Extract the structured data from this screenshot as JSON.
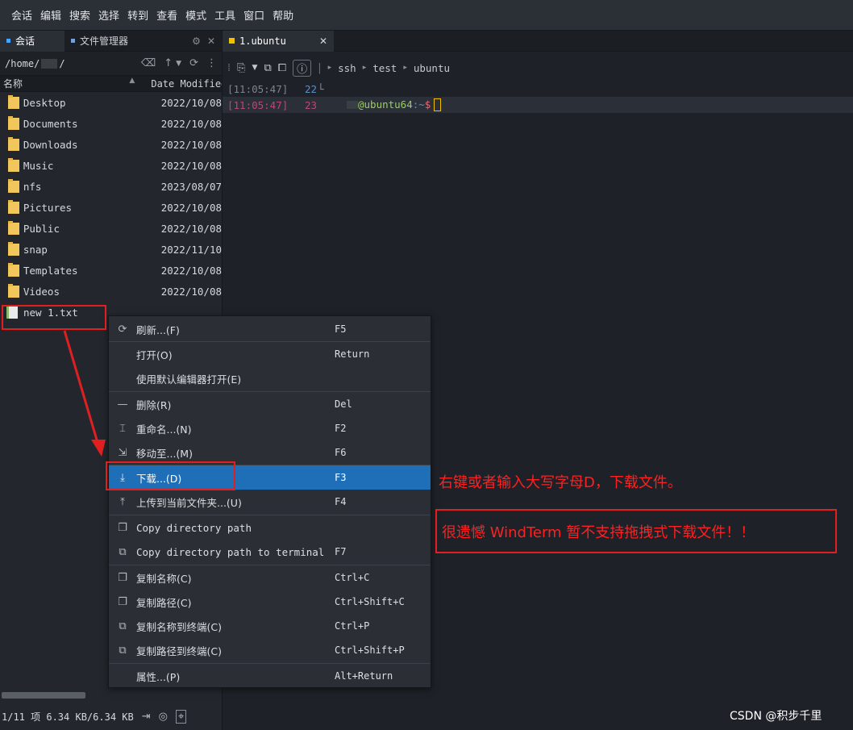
{
  "menubar": [
    "会话",
    "编辑",
    "搜索",
    "选择",
    "转到",
    "查看",
    "模式",
    "工具",
    "窗口",
    "帮助"
  ],
  "left_tabs": {
    "session": "会话",
    "file_manager": "文件管理器"
  },
  "path": {
    "prefix": "/home/",
    "suffix": "/"
  },
  "columns": {
    "name": "名称",
    "date": "Date Modified"
  },
  "files": [
    {
      "name": "Desktop",
      "date": "2022/10/08"
    },
    {
      "name": "Documents",
      "date": "2022/10/08"
    },
    {
      "name": "Downloads",
      "date": "2022/10/08"
    },
    {
      "name": "Music",
      "date": "2022/10/08"
    },
    {
      "name": "nfs",
      "date": "2023/08/07"
    },
    {
      "name": "Pictures",
      "date": "2022/10/08"
    },
    {
      "name": "Public",
      "date": "2022/10/08"
    },
    {
      "name": "snap",
      "date": "2022/11/10"
    },
    {
      "name": "Templates",
      "date": "2022/10/08"
    },
    {
      "name": "Videos",
      "date": "2022/10/08"
    }
  ],
  "selected_file": "new 1.txt",
  "status": "1/11 项 6.34 KB/6.34 KB",
  "terminal_tab": "1.ubuntu",
  "breadcrumb": [
    "ssh",
    "test",
    "ubuntu"
  ],
  "terminal_lines": [
    {
      "time": "[11:05:47]",
      "line": "22",
      "text": "└"
    },
    {
      "time": "[11:05:47]",
      "line": "23",
      "prompt": "@ubuntu64",
      "tilde": ":~",
      "dollar": "$"
    }
  ],
  "context_menu": {
    "refresh": {
      "label": "刷新...(F)",
      "shortcut": "F5"
    },
    "open": {
      "label": "打开(O)",
      "shortcut": "Return"
    },
    "open_default": {
      "label": "使用默认编辑器打开(E)",
      "shortcut": ""
    },
    "delete": {
      "label": "删除(R)",
      "shortcut": "Del"
    },
    "rename": {
      "label": "重命名...(N)",
      "shortcut": "F2"
    },
    "move": {
      "label": "移动至...(M)",
      "shortcut": "F6"
    },
    "download": {
      "label": "下载...(D)",
      "shortcut": "F3"
    },
    "upload": {
      "label": "上传到当前文件夹...(U)",
      "shortcut": "F4"
    },
    "copy_dir": {
      "label": "Copy directory path",
      "shortcut": ""
    },
    "copy_dir_term": {
      "label": "Copy directory path to terminal",
      "shortcut": "F7"
    },
    "copy_name": {
      "label": "复制名称(C)",
      "shortcut": "Ctrl+C"
    },
    "copy_path": {
      "label": "复制路径(C)",
      "shortcut": "Ctrl+Shift+C"
    },
    "copy_name_term": {
      "label": "复制名称到终端(C)",
      "shortcut": "Ctrl+P"
    },
    "copy_path_term": {
      "label": "复制路径到终端(C)",
      "shortcut": "Ctrl+Shift+P"
    },
    "properties": {
      "label": "属性...(P)",
      "shortcut": "Alt+Return"
    }
  },
  "annotations": {
    "note1": "右键或者输入大写字母D，下载文件。",
    "note2": "很遗憾 WindTerm 暂不支持拖拽式下载文件！！"
  },
  "watermark": "CSDN @积步千里",
  "colors": {
    "accent": "#1f6fb8",
    "annotation": "#e02020",
    "folder": "#f1c65b"
  }
}
